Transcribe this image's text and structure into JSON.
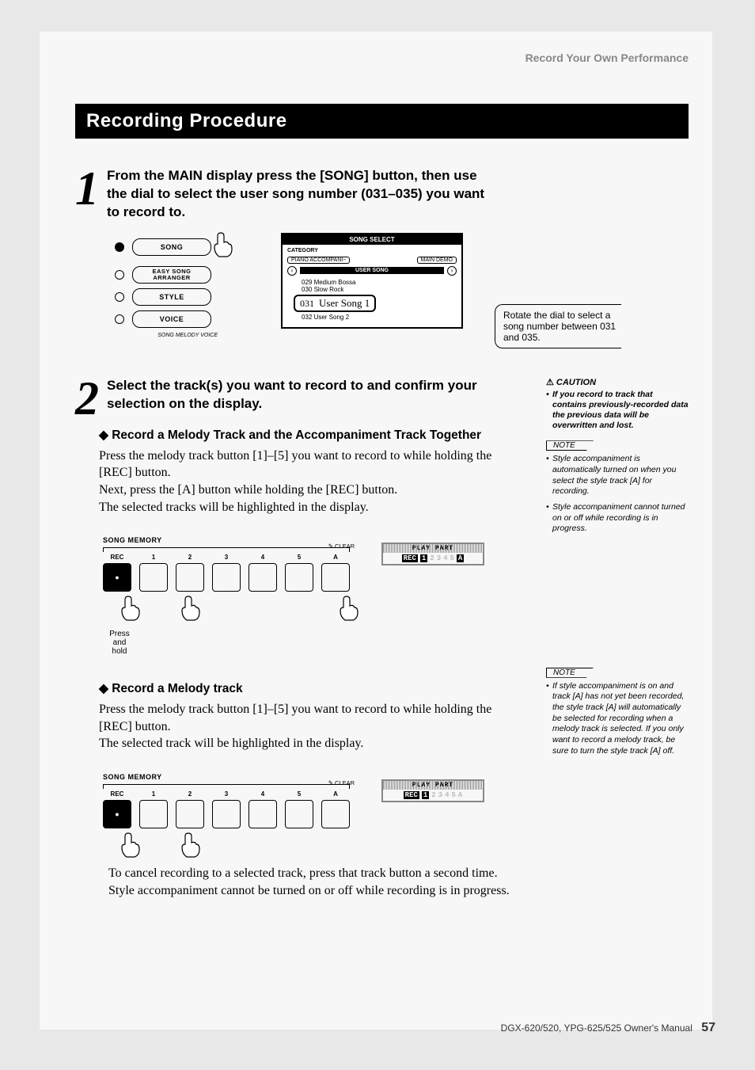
{
  "header": {
    "title": "Record Your Own Performance"
  },
  "section": {
    "title": "Recording Procedure"
  },
  "step1": {
    "text": "From the MAIN display press the [SONG] button, then use the dial to select the user song number (031–035) you want to record to.",
    "panel": {
      "btn1": "SONG",
      "btn2": "EASY SONG\nARRANGER",
      "btn3": "STYLE",
      "btn4": "VOICE",
      "sublabel": "SONG MELODY VOICE"
    },
    "lcd": {
      "title": "SONG SELECT",
      "category": "CATEGORY",
      "chip1": "PIANO ACCOMPANI~",
      "chip2": "MAIN DEMO",
      "bar": "USER SONG",
      "songs": {
        "s029": "029  Medium Bossa",
        "s030": "030  Slow Rock",
        "selNum": "031",
        "selName": "User Song 1",
        "s032": "032  User Song 2"
      }
    },
    "callout": "Rotate the dial to select a song number between 031 and 035."
  },
  "step2": {
    "text": "Select the track(s) you want to record to and confirm your selection on the display.",
    "caution": {
      "label": "CAUTION",
      "body": "If you record to track that contains previously-recorded data the previous data will be overwritten and lost."
    },
    "note1": {
      "label": "NOTE",
      "items": [
        "Style accompaniment is automatically turned on when you select the style track [A] for recording.",
        "Style accompaniment cannot turned on or off while recording is in progress."
      ]
    },
    "subA": {
      "title": "Record a Melody Track and the Accompaniment Track Together",
      "p1": "Press the melody track button [1]–[5] you want to record to while holding the [REC] button.",
      "p2": "Next, press the [A] button while holding the [REC] button.",
      "p3": "The selected tracks will be highlighted in the display."
    },
    "songMemory": {
      "label": "SONG MEMORY",
      "rec": "REC",
      "b1": "1",
      "b2": "2",
      "b3": "3",
      "b4": "4",
      "b5": "5",
      "bA": "A",
      "clear": "CLEAR",
      "pressHold": "Press and hold"
    },
    "playPartA": {
      "title": "PLAY PART",
      "rec": "REC",
      "c1": "1",
      "c2": "2",
      "c3": "3",
      "c4": "4",
      "c5": "5",
      "cA": "A"
    },
    "subB": {
      "title": "Record a Melody track",
      "p1": "Press the melody track button [1]–[5] you want to record to while holding the [REC] button.",
      "p2": "The selected track will be highlighted in the display."
    },
    "note2": {
      "label": "NOTE",
      "item": "If style accompaniment is on and track [A] has not yet been recorded, the style track [A] will automatically be selected for recording when a melody track is selected. If you only want to record a melody track, be sure to turn the style track [A] off."
    },
    "playPartB": {
      "title": "PLAY PART",
      "rec": "REC",
      "c1": "1",
      "c2": "2",
      "c3": "3",
      "c4": "4",
      "c5": "5",
      "cA": "A"
    },
    "cancel": "To cancel recording to a selected track, press that track button a second time. Style accompaniment cannot be turned on or off while recording is in progress."
  },
  "footer": {
    "model": "DGX-620/520, YPG-625/525  Owner's Manual",
    "page": "57"
  }
}
